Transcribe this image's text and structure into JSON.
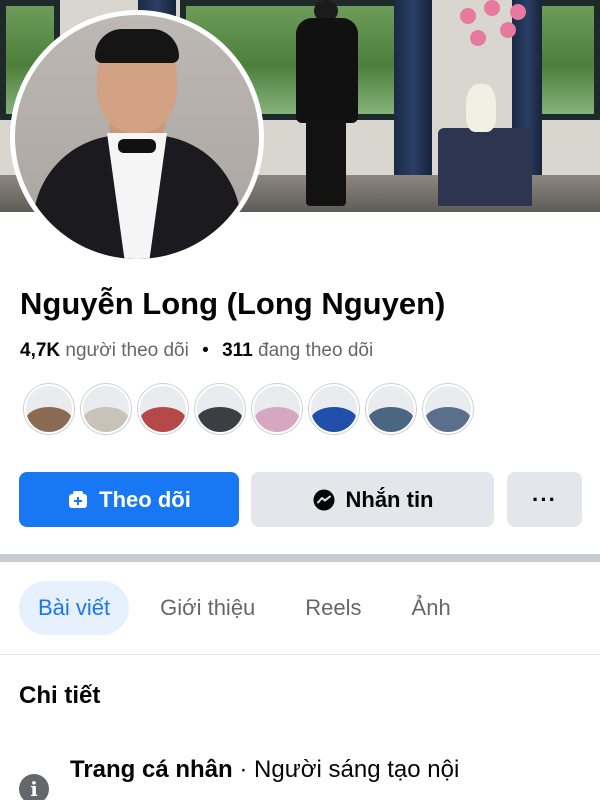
{
  "profile": {
    "name": "Nguyễn Long (Long Nguyen)",
    "followers_count": "4,7K",
    "followers_label": "người theo dõi",
    "separator": "•",
    "following_count": "311",
    "following_label": "đang theo dõi"
  },
  "friends": [
    {
      "color": "#8a6a52"
    },
    {
      "color": "#c9c2b8"
    },
    {
      "color": "#b54848"
    },
    {
      "color": "#3d3d44"
    },
    {
      "color": "#d6a7c0"
    },
    {
      "color": "#1f4fa8"
    },
    {
      "color": "#4a6680"
    },
    {
      "color": "#5b6f8c"
    }
  ],
  "actions": {
    "follow_label": "Theo dõi",
    "message_label": "Nhắn tin",
    "more_label": "···"
  },
  "tabs": [
    {
      "label": "Bài viết",
      "active": true
    },
    {
      "label": "Giới thiệu",
      "active": false
    },
    {
      "label": "Reels",
      "active": false
    },
    {
      "label": "Ảnh",
      "active": false
    }
  ],
  "details": {
    "title": "Chi tiết",
    "items": [
      {
        "icon": "info-icon",
        "glyph": "i",
        "strong": "Trang cá nhân",
        "text": " · Người sáng tạo nội"
      }
    ]
  },
  "colors": {
    "accent": "#1877f2",
    "secondary_button": "#e4e6eb",
    "muted_text": "#65676b"
  }
}
